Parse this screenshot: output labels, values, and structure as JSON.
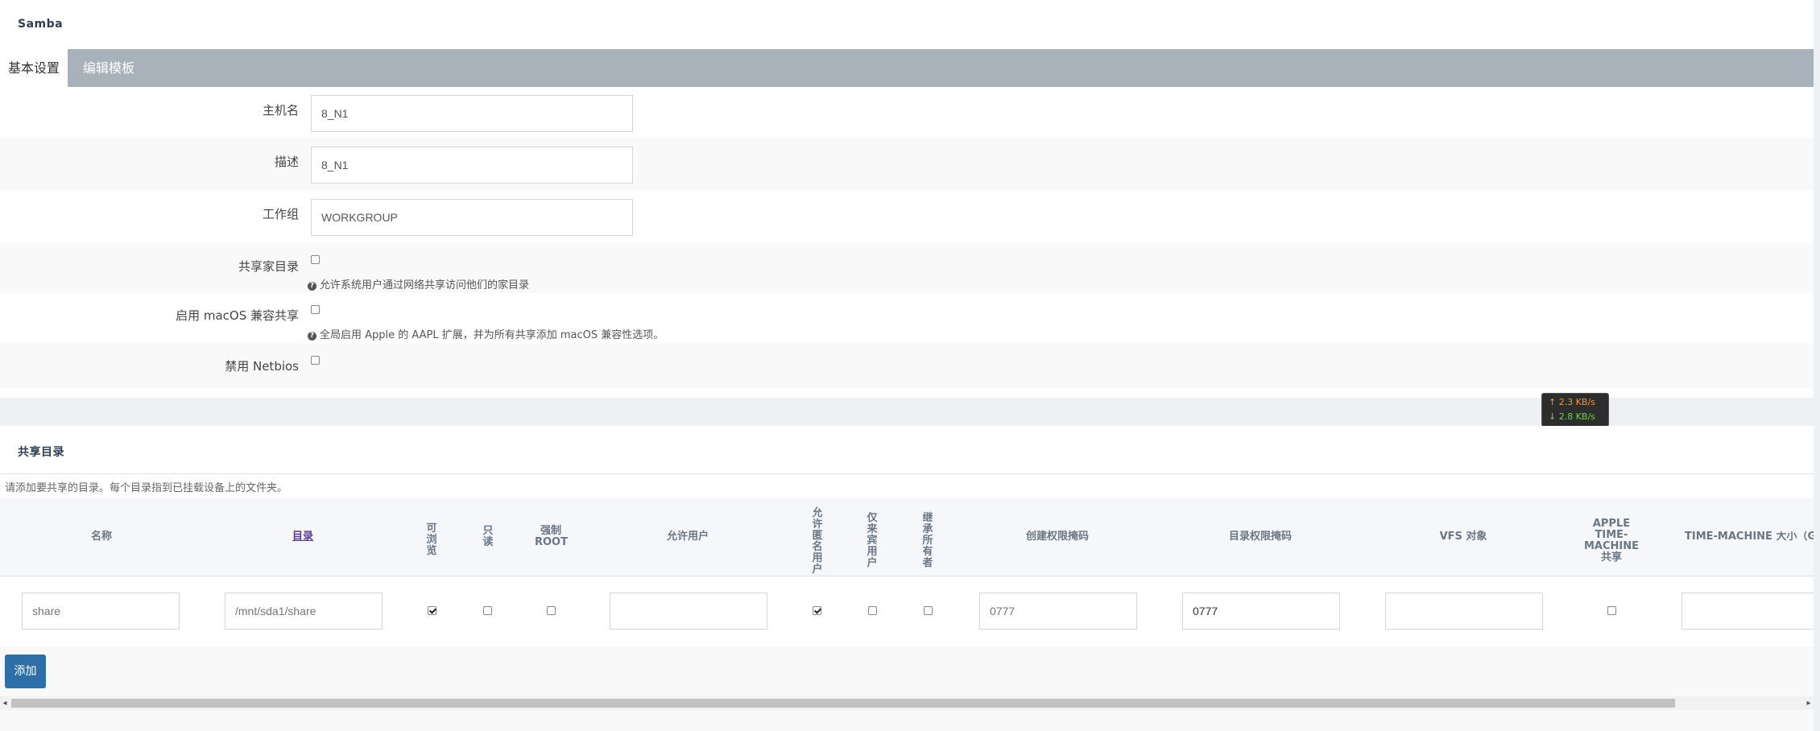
{
  "top_panel": {
    "title": "Samba",
    "tabs": [
      {
        "label": "基本设置"
      },
      {
        "label": "编辑模板"
      }
    ]
  },
  "settings": {
    "hostname": {
      "label": "主机名",
      "value": "8_N1"
    },
    "description": {
      "label": "描述",
      "value": "8_N1"
    },
    "workgroup": {
      "label": "工作组",
      "value": "WORKGROUP"
    },
    "share_homes": {
      "label": "共享家目录",
      "checked": false,
      "hint": "允许系统用户通过网络共享访问他们的家目录"
    },
    "macos": {
      "label": "启用 macOS 兼容共享",
      "checked": false,
      "hint": "全局启用 Apple 的 AAPL 扩展，并为所有共享添加 macOS 兼容性选项。"
    },
    "netbios": {
      "label": "禁用 Netbios",
      "checked": false
    }
  },
  "speed_widget": {
    "up": "↑ 2.3 KB/s",
    "down": "↓ 2.8 KB/s"
  },
  "shares": {
    "title": "共享目录",
    "description": "请添加要共享的目录。每个目录指到已挂载设备上的文件夹。",
    "columns": {
      "name": "名称",
      "path": "目录",
      "browseable": "可浏览",
      "readonly": "只读",
      "force_root": "强制ROOT",
      "users": "允许用户",
      "guest_ok": "允许匿名用户",
      "guest_only": "仅来宾用户",
      "inherit_owner": "继承所有者",
      "create_mask": "创建权限掩码",
      "dir_mask": "目录权限掩码",
      "vfs": "VFS 对象",
      "apple_tm": "APPLE TIME-MACHINE 共享",
      "tm_size": "TIME-MACHINE 大小（G"
    },
    "row": {
      "name_placeholder": "share",
      "path_placeholder": "/mnt/sda1/share",
      "browseable": true,
      "readonly": false,
      "force_root": false,
      "users": "",
      "guest_ok": true,
      "guest_only": false,
      "inherit_owner": false,
      "create_mask_placeholder": "0777",
      "dir_mask": "0777",
      "vfs": "",
      "apple_tm": false,
      "tm_size": ""
    },
    "add_button": "添加"
  },
  "scrollbar": {
    "left_arrow": "◂",
    "right_arrow": "▸"
  }
}
